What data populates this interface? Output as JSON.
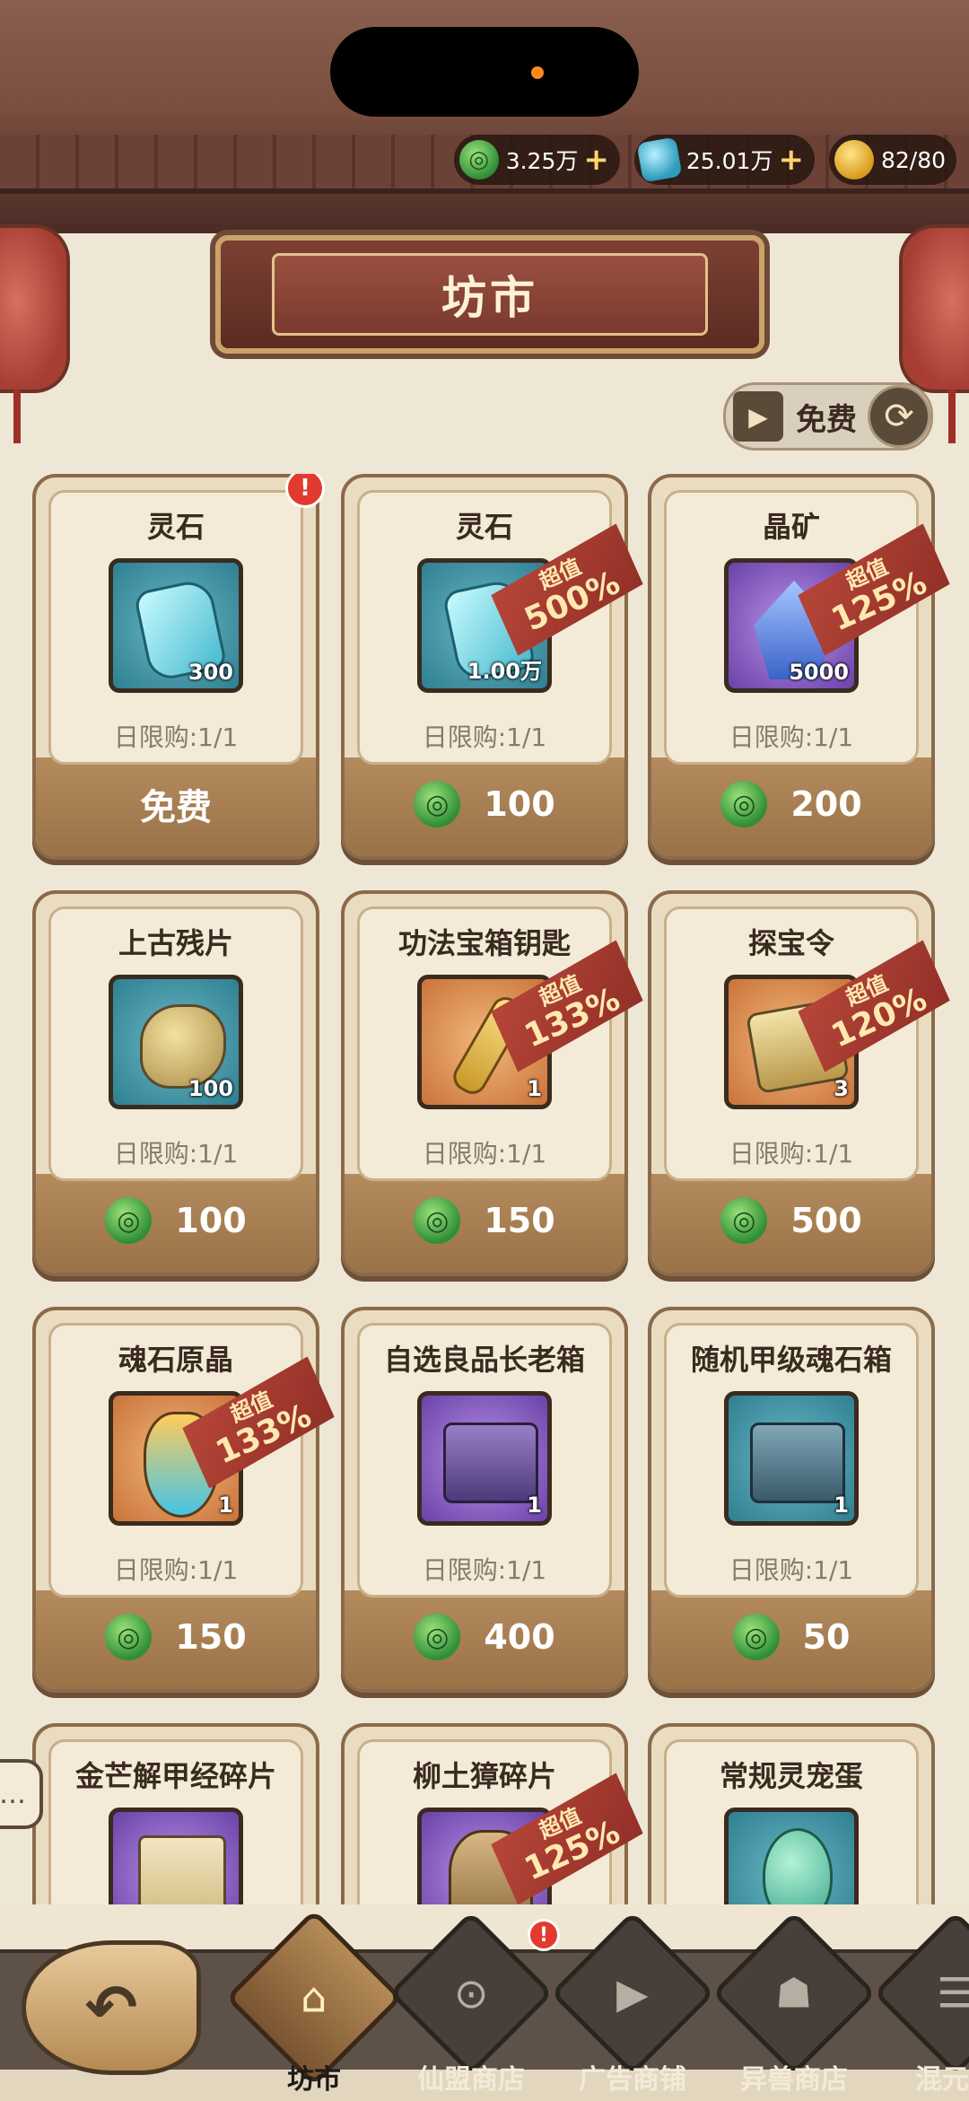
{
  "header": {
    "title": "坊市",
    "currencies": [
      {
        "icon": "jade-coin-icon",
        "value": "3.25万"
      },
      {
        "icon": "spirit-stone-icon",
        "value": "25.01万"
      },
      {
        "icon": "stamina-icon",
        "value": "82/80"
      }
    ],
    "refresh_label": "免费"
  },
  "items": [
    {
      "name": "灵石",
      "qty": "300",
      "limit": "日限购:1/1",
      "price": "免费",
      "free": true,
      "icon": "spirit-stone-icon",
      "alert": true
    },
    {
      "name": "灵石",
      "qty": "1.00万",
      "limit": "日限购:1/1",
      "price": "100",
      "icon": "spirit-stone-icon",
      "badge": {
        "top": "超值",
        "pct": "500%"
      }
    },
    {
      "name": "晶矿",
      "qty": "5000",
      "limit": "日限购:1/1",
      "price": "200",
      "icon": "crystal-ore-icon",
      "badge": {
        "top": "超值",
        "pct": "125%"
      }
    },
    {
      "name": "上古残片",
      "qty": "100",
      "limit": "日限购:1/1",
      "price": "100",
      "icon": "ancient-fragment-icon"
    },
    {
      "name": "功法宝箱钥匙",
      "qty": "1",
      "limit": "日限购:1/1",
      "price": "150",
      "icon": "key-icon",
      "badge": {
        "top": "超值",
        "pct": "133%"
      }
    },
    {
      "name": "探宝令",
      "qty": "3",
      "limit": "日限购:1/1",
      "price": "500",
      "icon": "treasure-token-icon",
      "badge": {
        "top": "超值",
        "pct": "120%"
      }
    },
    {
      "name": "魂石原晶",
      "qty": "1",
      "limit": "日限购:1/1",
      "price": "150",
      "icon": "soul-crystal-icon",
      "badge": {
        "top": "超值",
        "pct": "133%"
      }
    },
    {
      "name": "自选良品长老箱",
      "qty": "1",
      "limit": "日限购:1/1",
      "price": "400",
      "icon": "elder-chest-icon"
    },
    {
      "name": "随机甲级魂石箱",
      "qty": "1",
      "limit": "日限购:1/1",
      "price": "50",
      "icon": "random-chest-icon"
    },
    {
      "name": "金芒解甲经碎片",
      "icon": "scroll-fragment-icon"
    },
    {
      "name": "柳土獐碎片",
      "icon": "beast-fragment-icon",
      "badge": {
        "top": "超值",
        "pct": "125%"
      }
    },
    {
      "name": "常规灵宠蛋",
      "icon": "pet-egg-icon"
    }
  ],
  "nav": {
    "tabs": [
      {
        "label": "坊市",
        "icon": "pagoda-icon",
        "active": true
      },
      {
        "label": "仙盟商店",
        "icon": "coin-icon"
      },
      {
        "label": "广告商铺",
        "icon": "video-icon"
      },
      {
        "label": "异兽商店",
        "icon": "beast-icon"
      },
      {
        "label": "混元商",
        "icon": "scroll-icon"
      }
    ]
  },
  "colors": {
    "accent": "#9a7247",
    "jade": "#2f8e36",
    "ribbon": "#b9473a",
    "alert": "#e23a2f"
  }
}
